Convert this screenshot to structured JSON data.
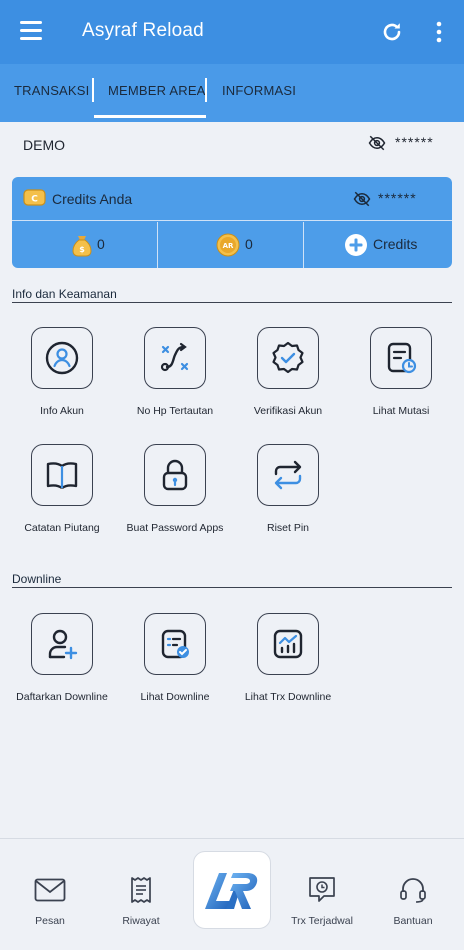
{
  "app": {
    "title": "Asyraf Reload"
  },
  "tabs": [
    {
      "label": "TRANSAKSI"
    },
    {
      "label": "MEMBER AREA"
    },
    {
      "label": "INFORMASI"
    }
  ],
  "account": {
    "name": "DEMO",
    "masked_balance": "******"
  },
  "credits": {
    "label": "Credits Anda",
    "masked_value": "******",
    "balance_count": "0",
    "ar_points": "0",
    "add_label": "Credits"
  },
  "sections": {
    "security": {
      "title": "Info dan Keamanan",
      "items": [
        {
          "label": "Info Akun"
        },
        {
          "label": "No Hp Tertautan"
        },
        {
          "label": "Verifikasi Akun"
        },
        {
          "label": "Lihat Mutasi"
        },
        {
          "label": "Catatan Piutang"
        },
        {
          "label": "Buat Password Apps"
        },
        {
          "label": "Riset Pin"
        }
      ]
    },
    "downline": {
      "title": "Downline",
      "items": [
        {
          "label": "Daftarkan Downline"
        },
        {
          "label": "Lihat Downline"
        },
        {
          "label": "Lihat Trx Downline"
        }
      ]
    }
  },
  "bottom_nav": [
    {
      "label": "Pesan"
    },
    {
      "label": "Riwayat"
    },
    {
      "label": "AR"
    },
    {
      "label": "Trx Terjadwal"
    },
    {
      "label": "Bantuan"
    }
  ],
  "colors": {
    "primary": "#3d8fe2",
    "tab_bar": "#4a9ae8",
    "card": "#4d9de9",
    "icon_accent": "#3d8fe2"
  }
}
